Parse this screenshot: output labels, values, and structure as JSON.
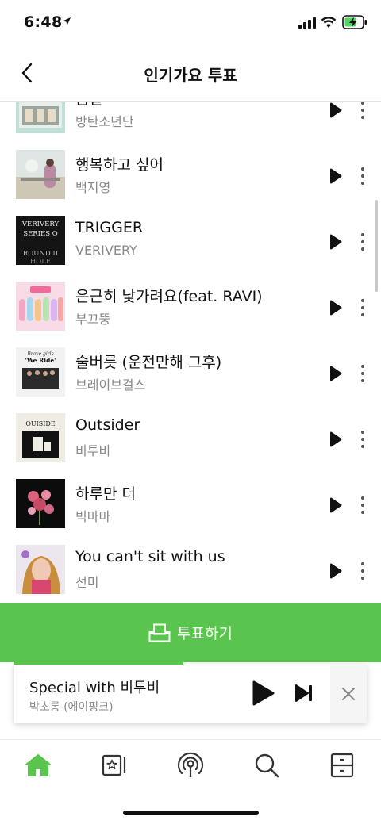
{
  "status": {
    "time": "6:48"
  },
  "header": {
    "title": "인기가요 투표"
  },
  "songs": [
    {
      "title": "봄날",
      "artist": "방탄소년단"
    },
    {
      "title": "행복하고 싶어",
      "artist": "백지영"
    },
    {
      "title": "TRIGGER",
      "artist": "VERIVERY"
    },
    {
      "title": "은근히 낯가려요(feat. RAVI)",
      "artist": "부끄뚱"
    },
    {
      "title": "술버릇 (운전만해 그후)",
      "artist": "브레이브걸스"
    },
    {
      "title": "Outsider",
      "artist": "비투비"
    },
    {
      "title": "하루만 더",
      "artist": "빅마마"
    },
    {
      "title": "You can't sit with us",
      "artist": "선미"
    }
  ],
  "album_text": {
    "trigger": [
      "VERIVERY",
      "SERIES O",
      "ROUND II",
      "HOLE"
    ],
    "weride_brand": "Brave girls",
    "weride": "'We Ride'",
    "outsider": "OUISIDE"
  },
  "vote": {
    "label": "투표하기"
  },
  "mini_player": {
    "title": "Special with 비투비",
    "artist": "박초롱 (에이핑크)",
    "progress": 0.48
  },
  "tabs": [
    "home",
    "library",
    "podcast",
    "search",
    "more"
  ],
  "colors": {
    "accent": "#5ac54e",
    "text": "#111111",
    "subtext": "#888888"
  }
}
